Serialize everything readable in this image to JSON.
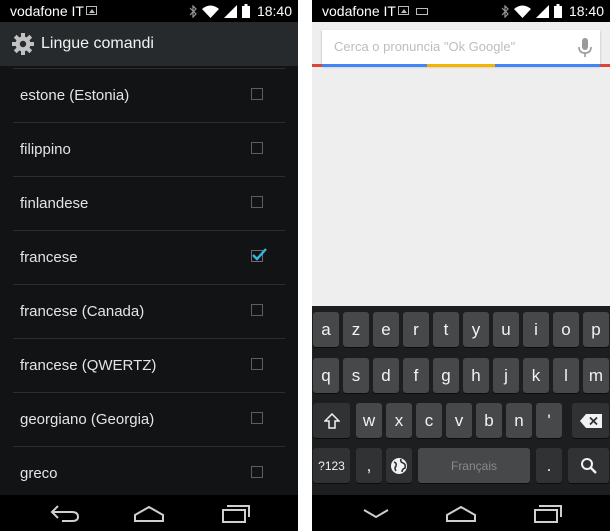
{
  "left_screen": {
    "status": {
      "carrier": "vodafone IT",
      "time": "18:40"
    },
    "header": {
      "title": "Lingue comandi",
      "icon": "gear-icon"
    },
    "languages": [
      {
        "label": "estone (Estonia)",
        "checked": false
      },
      {
        "label": "filippino",
        "checked": false
      },
      {
        "label": "finlandese",
        "checked": false
      },
      {
        "label": "francese",
        "checked": true
      },
      {
        "label": "francese (Canada)",
        "checked": false
      },
      {
        "label": "francese (QWERTZ)",
        "checked": false
      },
      {
        "label": "georgiano (Georgia)",
        "checked": false
      },
      {
        "label": "greco",
        "checked": false
      }
    ]
  },
  "right_screen": {
    "status": {
      "carrier": "vodafone IT",
      "time": "18:40"
    },
    "search": {
      "placeholder": "Cerca o pronuncia \"Ok Google\""
    },
    "keyboard": {
      "row1": [
        "a",
        "z",
        "e",
        "r",
        "t",
        "y",
        "u",
        "i",
        "o",
        "p"
      ],
      "row2": [
        "q",
        "s",
        "d",
        "f",
        "g",
        "h",
        "j",
        "k",
        "l",
        "m"
      ],
      "row3": [
        "w",
        "x",
        "c",
        "v",
        "b",
        "n",
        "'"
      ],
      "symbols_key": "?123",
      "comma_key": ",",
      "space_key": "Français",
      "period_key": "."
    }
  },
  "colors": {
    "accent": "#33b5e5",
    "google_blue": "#4285f4",
    "google_red": "#db4437",
    "google_yellow": "#f4b400",
    "google_green": "#0f9d58"
  }
}
